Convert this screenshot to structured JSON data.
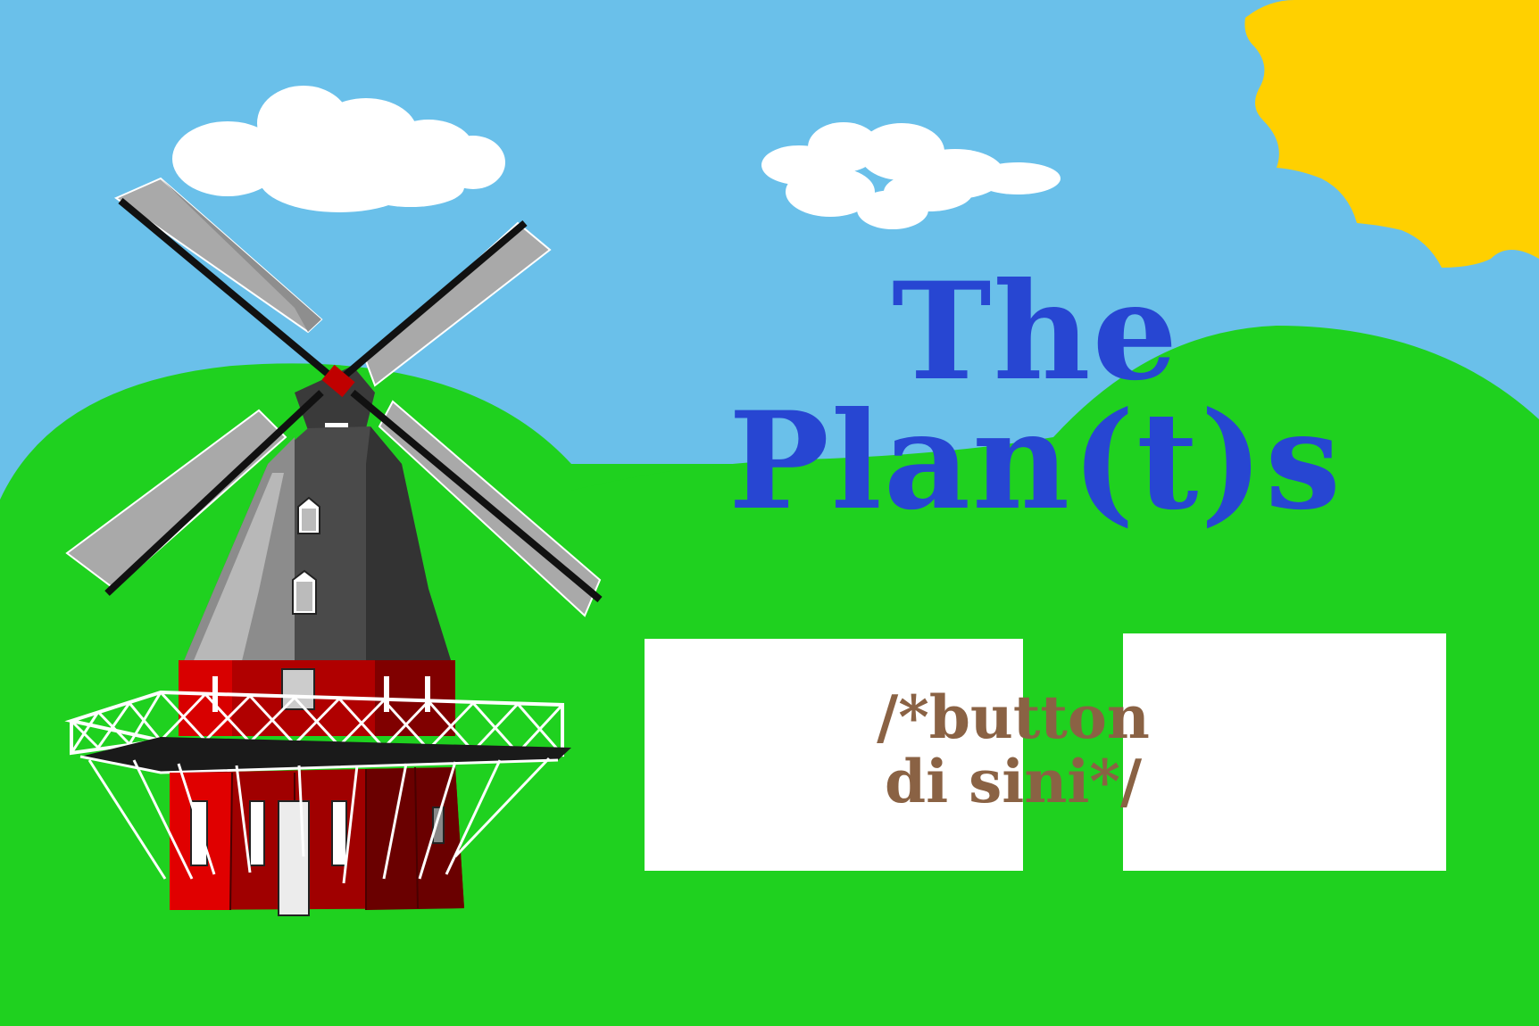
{
  "title": {
    "line1": "The",
    "line2": "Plan(t)s"
  },
  "buttons": {
    "placeholder_line1": "/*button",
    "placeholder_line2": "di sini*/"
  },
  "colors": {
    "sky": "#6ac0ea",
    "grass": "#1fd11f",
    "sun": "#ffd000",
    "title": "#2746d2",
    "button_text": "#8a6244",
    "button_bg": "#ffffff"
  },
  "icons": [
    "sun-icon",
    "cloud-icon",
    "windmill-icon"
  ]
}
